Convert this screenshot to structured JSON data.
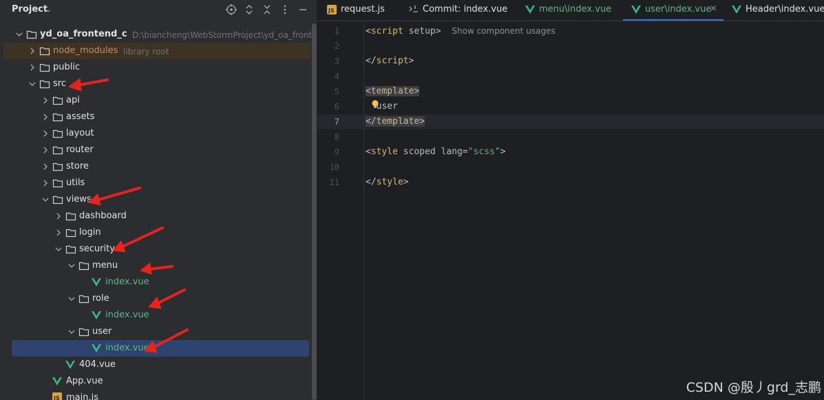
{
  "project_panel": {
    "title": "Project",
    "tree": [
      {
        "label": "yd_oa_frontend_c",
        "hint": "D:\\biancheng\\WebStormProject\\yd_oa_frontend_c",
        "type": "folder",
        "bold": true
      },
      {
        "label": "node_modules",
        "hint": "library root",
        "type": "folder"
      },
      {
        "label": "public",
        "type": "folder"
      },
      {
        "label": "src",
        "type": "folder"
      },
      {
        "label": "api",
        "type": "folder"
      },
      {
        "label": "assets",
        "type": "folder"
      },
      {
        "label": "layout",
        "type": "folder"
      },
      {
        "label": "router",
        "type": "folder"
      },
      {
        "label": "store",
        "type": "folder"
      },
      {
        "label": "utils",
        "type": "folder"
      },
      {
        "label": "views",
        "type": "folder"
      },
      {
        "label": "dashboard",
        "type": "folder"
      },
      {
        "label": "login",
        "type": "folder"
      },
      {
        "label": "security",
        "type": "folder"
      },
      {
        "label": "menu",
        "type": "folder"
      },
      {
        "label": "index.vue",
        "type": "vue"
      },
      {
        "label": "role",
        "type": "folder"
      },
      {
        "label": "index.vue",
        "type": "vue"
      },
      {
        "label": "user",
        "type": "folder"
      },
      {
        "label": "index.vue",
        "type": "vue"
      },
      {
        "label": "404.vue",
        "type": "vue"
      },
      {
        "label": "App.vue",
        "type": "vue"
      },
      {
        "label": "main.js",
        "type": "js"
      }
    ]
  },
  "tabs": [
    {
      "label": "request.js",
      "icon": "js-icon"
    },
    {
      "label": "Commit: index.vue",
      "icon": "commit-icon"
    },
    {
      "label": "menu\\index.vue",
      "icon": "vue-icon"
    },
    {
      "label": "user\\index.vue",
      "icon": "vue-icon",
      "active": true
    },
    {
      "label": "Header\\index.vue",
      "icon": "vue-icon"
    }
  ],
  "editor": {
    "line_numbers": [
      "1",
      "2",
      "3",
      "4",
      "5",
      "6",
      "7",
      "8",
      "9",
      "10",
      "11"
    ],
    "current_line": 7,
    "lines": {
      "l1_open": "<",
      "l1_tag": "script",
      "l1_attr": " setup",
      "l1_close": ">",
      "l1_inlay": "Show component usages",
      "l3_open": "</",
      "l3_tag": "script",
      "l3_close": ">",
      "l5_open": "<",
      "l5_tag": "template",
      "l5_close": ">",
      "l6_text": "user",
      "l7_open": "</",
      "l7_tag": "template",
      "l7_close": ">",
      "l9_open": "<",
      "l9_tag": "style",
      "l9_attr": " scoped lang=",
      "l9_str": "\"scss\"",
      "l9_close": ">",
      "l11_open": "</",
      "l11_tag": "style",
      "l11_close": ">"
    }
  },
  "watermark": "CSDN @殷丿grd_志鹏",
  "colors": {
    "accent": "#3574f0",
    "vue_green": "#41b883",
    "arrow_red": "#e8231d"
  }
}
